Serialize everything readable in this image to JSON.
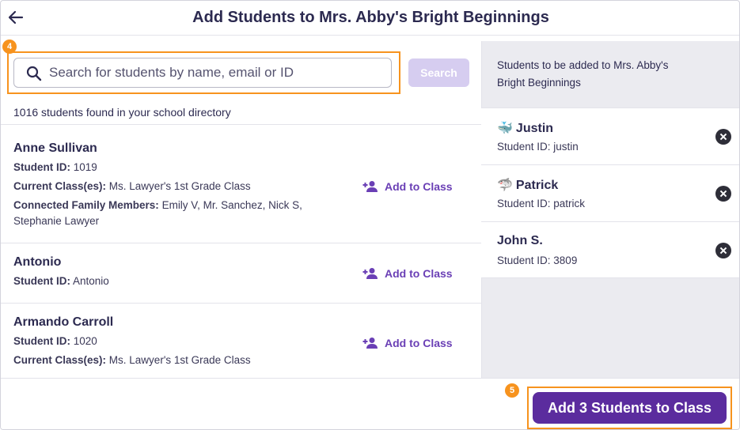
{
  "header": {
    "title": "Add Students to Mrs. Abby's Bright Beginnings",
    "back_icon": "arrow-left-icon"
  },
  "search": {
    "step_badge": "4",
    "placeholder": "Search for students by name, email or ID",
    "value": "",
    "button_label": "Search",
    "results_text": "1016 students found in your school directory"
  },
  "students": [
    {
      "name": "Anne Sullivan",
      "id_label": "Student ID:",
      "id": "1019",
      "class_label": "Current Class(es):",
      "classes": "Ms. Lawyer's 1st Grade Class",
      "family_label": "Connected Family Members:",
      "family_line1": "Emily V, Mr. Sanchez, Nick S,",
      "family_line2": "Stephanie Lawyer",
      "action": "Add to Class"
    },
    {
      "name": "Antonio",
      "id_label": "Student ID:",
      "id": "Antonio",
      "action": "Add to Class"
    },
    {
      "name": "Armando Carroll",
      "id_label": "Student ID:",
      "id": "1020",
      "class_label": "Current Class(es):",
      "classes": "Ms. Lawyer's 1st Grade Class",
      "action": "Add to Class"
    }
  ],
  "selected": {
    "heading_line1": "Students to be added to Mrs. Abby's",
    "heading_line2": "Bright Beginnings",
    "items": [
      {
        "emoji": "🐳",
        "name": "Justin",
        "id_text": "Student ID: justin"
      },
      {
        "emoji": "🦈",
        "name": "Patrick",
        "id_text": "Student ID: patrick"
      },
      {
        "emoji": "",
        "name": "John S.",
        "id_text": "Student ID: 3809"
      }
    ]
  },
  "footer": {
    "step_badge": "5",
    "primary_label": "Add 3 Students to Class"
  },
  "colors": {
    "accent": "#5b2c9e",
    "link": "#6a3fb5",
    "highlight": "#f7931e",
    "disabled_button": "#d6cdf0",
    "panel_bg": "#ebebf0"
  }
}
